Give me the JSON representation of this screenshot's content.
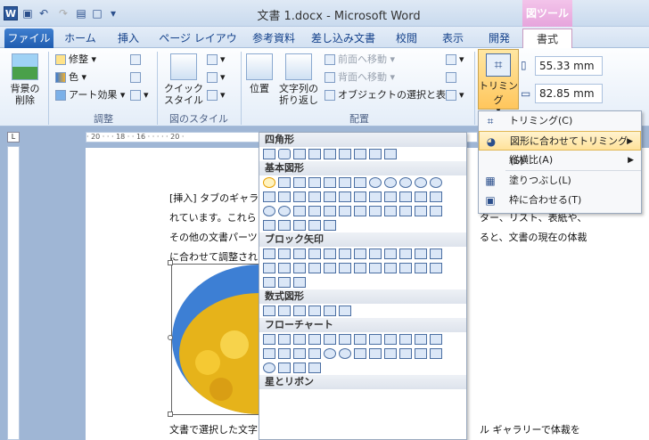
{
  "titlebar": {
    "title": "文書 1.docx - Microsoft Word",
    "context_tab": "図ツール"
  },
  "tabs": [
    "ファイル",
    "ホーム",
    "挿入",
    "ページ レイアウト",
    "参考資料",
    "差し込み文書",
    "校閲",
    "表示",
    "開発",
    "書式"
  ],
  "ribbon": {
    "remove_bg": "背景の\n削除",
    "adjust": {
      "correct": "修整",
      "color": "色",
      "art": "アート効果",
      "label": "調整"
    },
    "style": {
      "quick": "クイック\nスタイル",
      "label": "図のスタイル"
    },
    "arrange": {
      "position": "位置",
      "wrap": "文字列の\n折り返し",
      "front": "前面へ移動",
      "back": "背面へ移動",
      "select": "オブジェクトの選択と表示",
      "label": "配置"
    },
    "trim": "トリミング",
    "height": "55.33 mm",
    "width": "82.85 mm"
  },
  "shapes_panel": {
    "sections": [
      "四角形",
      "基本図形",
      "ブロック矢印",
      "数式図形",
      "フローチャート",
      "星とリボン"
    ]
  },
  "context_menu": [
    {
      "label": "トリミング(C)",
      "icon": "crop-icon",
      "submenu": false
    },
    {
      "label": "図形に合わせてトリミング(S)",
      "icon": "shape-crop-icon",
      "submenu": true,
      "highlighted": true
    },
    {
      "label": "縦横比(A)",
      "icon": "",
      "submenu": true
    },
    {
      "label": "塗りつぶし(L)",
      "icon": "fill-icon",
      "submenu": false
    },
    {
      "label": "枠に合わせる(T)",
      "icon": "fit-icon",
      "submenu": false
    }
  ],
  "document": {
    "line1": "[挿入] タブのギャラ",
    "line2": "れています。これら",
    "line2b": "ター、リスト、表紙や、",
    "line3": "その他の文書パーツ",
    "line3b": "ると、文書の現在の体裁",
    "line4": "に合わせて調整され",
    "line5": "文書で選択した文字",
    "line5b": "ル ギャラリーで体裁を"
  },
  "ruler_marks": "· 20 · · · 18 · · 16 · · · · · 20 ·"
}
